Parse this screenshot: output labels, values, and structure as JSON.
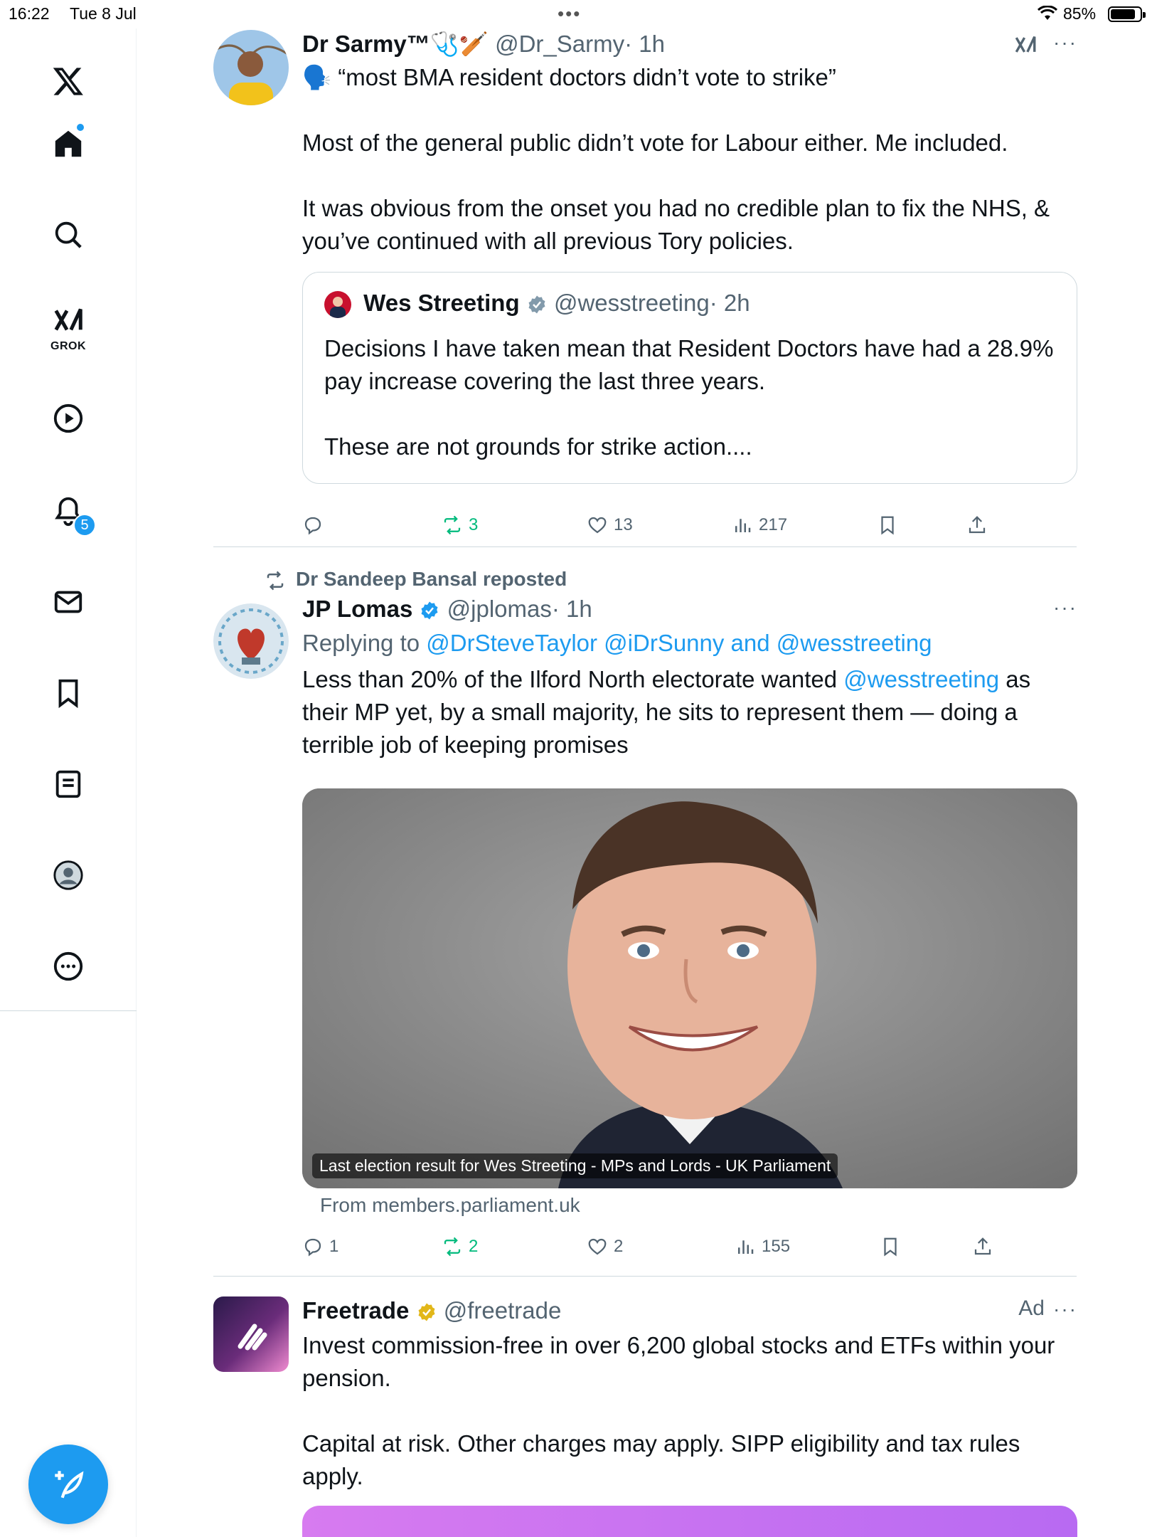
{
  "status_bar": {
    "time": "16:22",
    "date": "Tue 8 Jul",
    "battery": "85%",
    "multitask_dots": "•••"
  },
  "sidebar": {
    "items": [
      {
        "label": "X",
        "icon": "x-logo-icon"
      },
      {
        "label": "Home",
        "icon": "home-icon"
      },
      {
        "label": "Search",
        "icon": "search-icon"
      },
      {
        "label": "Grok",
        "icon": "grok-icon",
        "caption": "GROK"
      },
      {
        "label": "Video",
        "icon": "play-icon"
      },
      {
        "label": "Notifications",
        "icon": "bell-icon",
        "badge": "5"
      },
      {
        "label": "Messages",
        "icon": "mail-icon"
      },
      {
        "label": "Bookmarks",
        "icon": "bookmark-icon"
      },
      {
        "label": "Lists",
        "icon": "list-icon"
      },
      {
        "label": "Profile",
        "icon": "profile-icon"
      },
      {
        "label": "More",
        "icon": "more-icon"
      }
    ]
  },
  "tweets": [
    {
      "name": "Dr Sarmy™🩺🏏",
      "handle": "@Dr_Sarmy",
      "time": "· 1h",
      "text": [
        "🗣️ “most BMA resident doctors didn’t vote to strike”",
        "",
        "Most of the general public didn’t vote for Labour either. Me included.",
        "",
        "It was obvious from the onset you had no credible plan to fix the NHS, & you’ve continued with all previous Tory policies."
      ],
      "quote": {
        "name": "Wes Streeting",
        "handle": "@wesstreeting",
        "time": "· 2h",
        "text": [
          "Decisions I have taken mean that Resident Doctors have had a 28.9% pay increase covering the last three years.",
          "",
          "These are not grounds for strike action...."
        ]
      },
      "actions": {
        "replies": "",
        "reposts": "3",
        "likes": "13",
        "views": "217"
      }
    },
    {
      "reposted_by": "Dr Sandeep Bansal reposted",
      "name": "JP Lomas",
      "handle": "@jplomas",
      "time": "· 1h",
      "replying_prefix": "Replying to ",
      "replying_to": "@DrSteveTaylor @iDrSunny and @wesstreeting",
      "text_before_mention": "Less than 20% of the Ilford North electorate wanted ",
      "mention": "@wesstreeting",
      "text_after_mention": " as their MP yet, by a small majority, he sits to represent them — doing a terrible job of keeping promises",
      "media_caption": "Last election result for Wes Streeting - MPs and Lords - UK Parliament",
      "media_source": "From members.parliament.uk",
      "actions": {
        "replies": "1",
        "reposts": "2",
        "likes": "2",
        "views": "155"
      }
    },
    {
      "name": "Freetrade",
      "handle": "@freetrade",
      "ad_label": "Ad",
      "text": [
        "Invest commission-free in over 6,200 global stocks and ETFs within your pension.",
        "",
        "Capital at risk. Other charges may apply. SIPP eligibility and tax rules apply."
      ]
    }
  ],
  "colors": {
    "accent": "#1d9bf0",
    "repost_green": "#00ba7c",
    "muted": "#536471",
    "verified_gold": "#e2b719"
  }
}
